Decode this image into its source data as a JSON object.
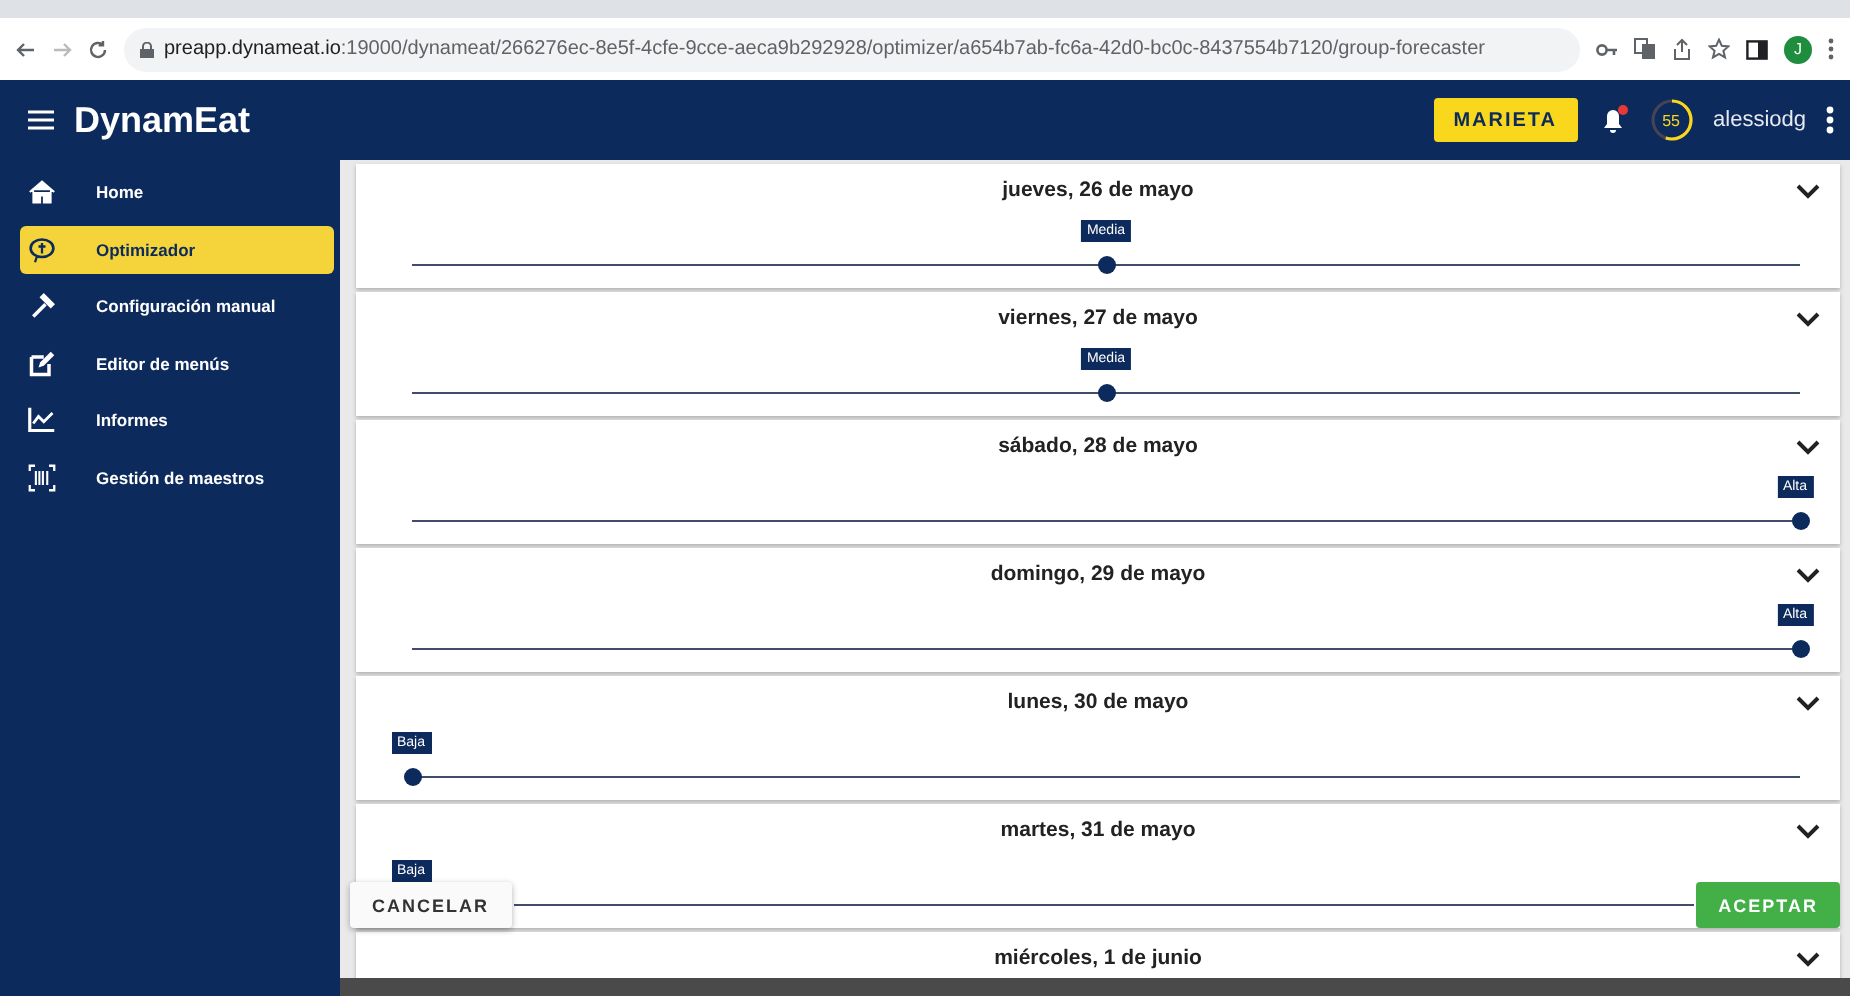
{
  "browser": {
    "url_host": "preapp.dynameat.io",
    "url_path": ":19000/dynameat/266276ec-8e5f-4cfe-9cce-aeca9b292928/optimizer/a654b7ab-fc6a-42d0-bc0c-8437554b7120/group-forecaster",
    "profile": "J"
  },
  "header": {
    "logo": "DynamEat",
    "company_button": "MARIETA",
    "has_notification": true,
    "score": "55",
    "user": "alessiodg"
  },
  "sidebar": {
    "items": [
      {
        "label": "Home",
        "selected": false
      },
      {
        "label": "Optimizador",
        "selected": true
      },
      {
        "label": "Configuración manual",
        "selected": false
      },
      {
        "label": "Editor de menús",
        "selected": false
      },
      {
        "label": "Informes",
        "selected": false
      },
      {
        "label": "Gestión de maestros",
        "selected": false
      }
    ]
  },
  "days": [
    {
      "title": "jueves, 26 de mayo",
      "label": "Media",
      "level": 0.5
    },
    {
      "title": "viernes, 27 de mayo",
      "label": "Media",
      "level": 0.5
    },
    {
      "title": "sábado, 28 de mayo",
      "label": "Alta",
      "level": 1
    },
    {
      "title": "domingo, 29 de mayo",
      "label": "Alta",
      "level": 1
    },
    {
      "title": "lunes, 30 de mayo",
      "label": "Baja",
      "level": 0
    },
    {
      "title": "martes, 31 de mayo",
      "label": "Baja",
      "level": 0
    },
    {
      "title": "miércoles, 1 de junio"
    }
  ],
  "actions": {
    "cancel": "CANCELAR",
    "accept": "ACEPTAR"
  }
}
